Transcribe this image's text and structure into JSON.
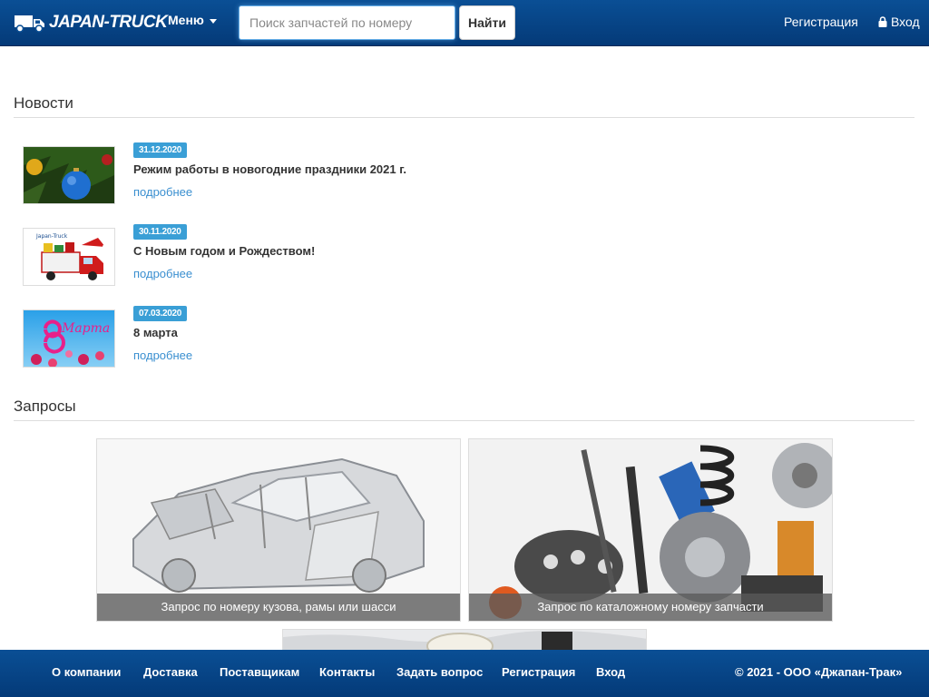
{
  "header": {
    "brand": "JAPAN-TRUCK",
    "menu_label": "Меню",
    "search_placeholder": "Поиск запчастей по номеру",
    "search_button": "Найти",
    "register": "Регистрация",
    "login": "Вход"
  },
  "news": {
    "title": "Новости",
    "items": [
      {
        "date": "31.12.2020",
        "title": "Режим работы в новогодние праздники 2021 г.",
        "more": "подробнее"
      },
      {
        "date": "30.11.2020",
        "title": "С Новым годом и Рождеством!",
        "more": "подробнее",
        "thumb_text": "Japan-Truck"
      },
      {
        "date": "07.03.2020",
        "title": "8 марта",
        "more": "подробнее",
        "thumb_text": "Марта"
      }
    ]
  },
  "requests": {
    "title": "Запросы",
    "items": [
      {
        "label": "Запрос по номеру кузова, рамы или шасси"
      },
      {
        "label": "Запрос по каталожному номеру запчасти"
      }
    ]
  },
  "footer": {
    "links": [
      "О компании",
      "Доставка",
      "Поставщикам",
      "Контакты",
      "Задать вопрос",
      "Регистрация",
      "Вход"
    ],
    "copyright": "© 2021 - ООО «Джапан-Трак»"
  },
  "colors": {
    "navbar": "#0a4f95",
    "badge": "#3a9fd6",
    "link": "#3a8fd0"
  }
}
